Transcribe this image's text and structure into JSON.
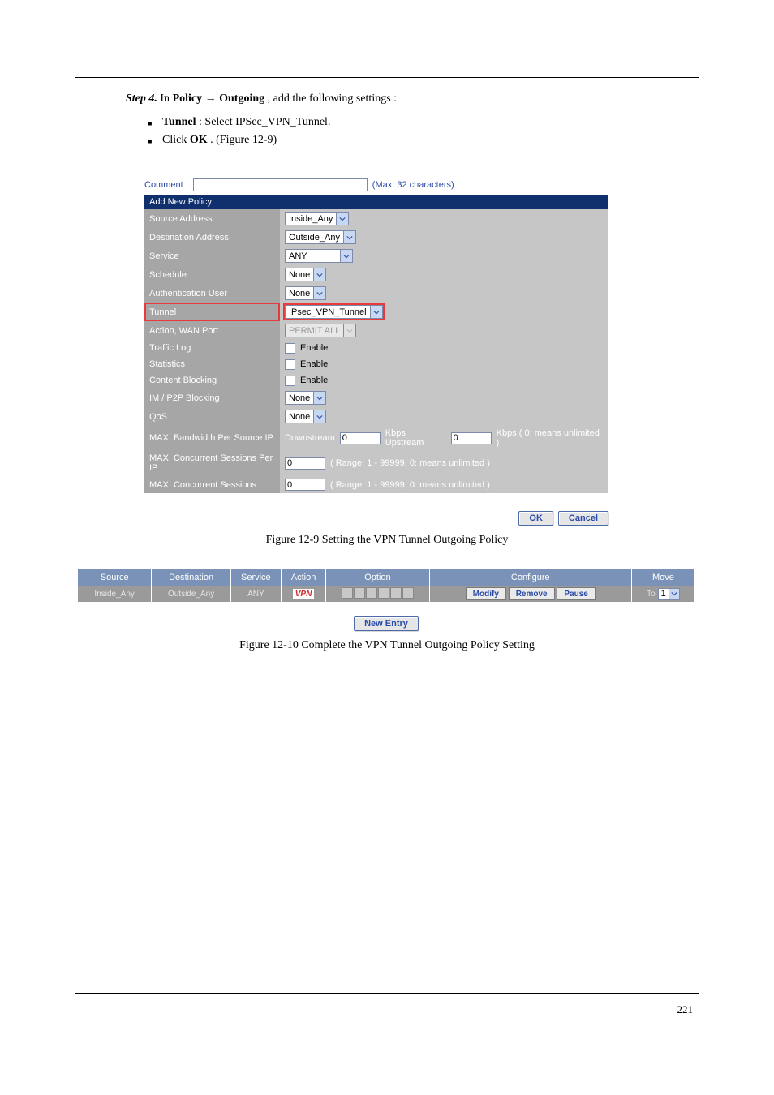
{
  "step": {
    "num": "Step 4.",
    "prefix": " In ",
    "menu1": "Policy",
    "arrow": " → ",
    "menu2": "Outgoing",
    "mid": ", add the following settings",
    "colon": ":"
  },
  "bullets": [
    {
      "label": "Tunnel",
      "suffix": ": Select IPSec_VPN_Tunnel."
    },
    {
      "prefix": "Click ",
      "label": "OK",
      "suffix": ". (Figure 12-9)"
    }
  ],
  "form": {
    "comment_label": "Comment :",
    "comment_value": "",
    "comment_hint": "(Max. 32 characters)",
    "titlebar": "Add New Policy",
    "rows": {
      "source_address": {
        "label": "Source Address",
        "value": "Inside_Any"
      },
      "destination_address": {
        "label": "Destination Address",
        "value": "Outside_Any"
      },
      "service": {
        "label": "Service",
        "value": "ANY"
      },
      "schedule": {
        "label": "Schedule",
        "value": "None"
      },
      "auth_user": {
        "label": "Authentication User",
        "value": "None"
      },
      "tunnel": {
        "label": "Tunnel",
        "value": "IPsec_VPN_Tunnel"
      },
      "action_wan": {
        "label": "Action, WAN Port",
        "value": "PERMIT ALL"
      },
      "traffic_log": {
        "label": "Traffic Log",
        "value": "Enable"
      },
      "statistics": {
        "label": "Statistics",
        "value": "Enable"
      },
      "content_blocking": {
        "label": "Content Blocking",
        "value": "Enable"
      },
      "im_p2p": {
        "label": "IM / P2P Blocking",
        "value": "None"
      },
      "qos": {
        "label": "QoS",
        "value": "None"
      },
      "max_bw": {
        "label": "MAX. Bandwidth Per Source IP",
        "down_label": "Downstream",
        "down_val": "0",
        "up_unit": "Kbps Upstream",
        "up_val": "0",
        "tail": "Kbps ( 0: means unlimited )"
      },
      "max_sess_ip": {
        "label": "MAX. Concurrent Sessions Per IP",
        "val": "0",
        "hint": "( Range: 1 - 99999, 0: means unlimited )"
      },
      "max_sess": {
        "label": "MAX. Concurrent Sessions",
        "val": "0",
        "hint": "( Range: 1 - 99999, 0: means unlimited )"
      }
    },
    "ok": "OK",
    "cancel": "Cancel"
  },
  "caption1": "Figure 12-9 Setting the VPN Tunnel Outgoing Policy",
  "table": {
    "headers": [
      "Source",
      "Destination",
      "Service",
      "Action",
      "Option",
      "Configure",
      "Move"
    ],
    "row": {
      "source": "Inside_Any",
      "destination": "Outside_Any",
      "service": "ANY",
      "action": "VPN",
      "modify": "Modify",
      "remove": "Remove",
      "pause": "Pause",
      "move_to": "To",
      "move_val": "1"
    },
    "new_entry": "New Entry"
  },
  "caption2": "Figure 12-10 Complete the VPN Tunnel Outgoing Policy Setting",
  "page_num": "221"
}
